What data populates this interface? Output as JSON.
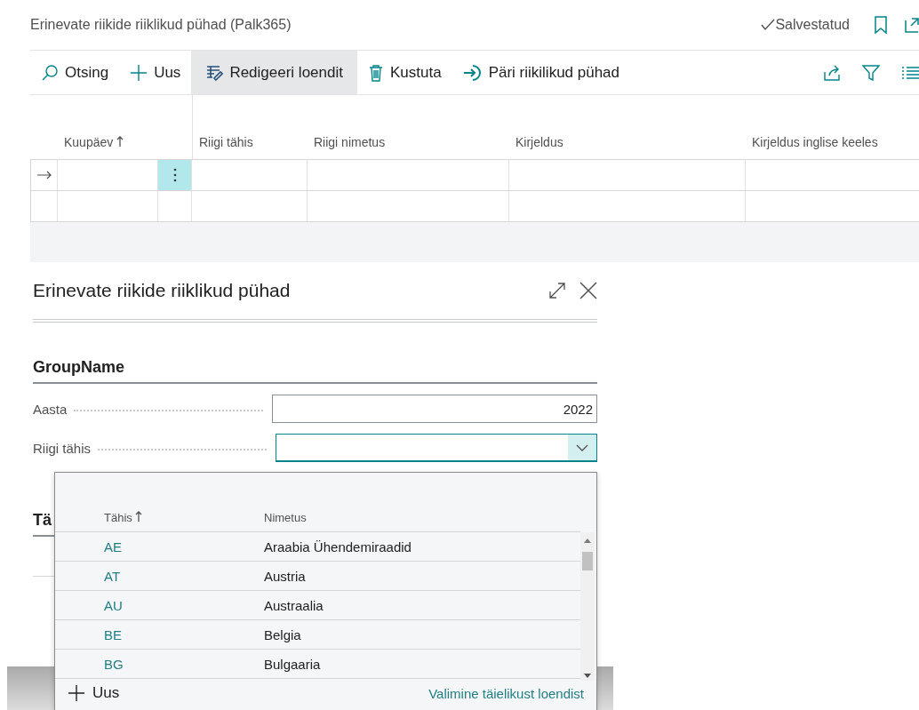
{
  "page": {
    "title": "Erinevate riikide riiklikud pühad (Palk365)",
    "status": "Salvestatud"
  },
  "actions": [
    {
      "label": "Otsing",
      "kind": "search",
      "highlighted": false
    },
    {
      "label": "Uus",
      "kind": "new",
      "highlighted": false
    },
    {
      "label": "Redigeeri loendit",
      "kind": "edit",
      "highlighted": true
    },
    {
      "label": "Kustuta",
      "kind": "delete",
      "highlighted": false
    },
    {
      "label": "Päri riikilikud pühad",
      "kind": "fetch",
      "highlighted": false
    }
  ],
  "grid": {
    "columns": [
      {
        "label": "Kuupäev",
        "sorted": true
      },
      {
        "label": "Riigi tähis",
        "sorted": false
      },
      {
        "label": "Riigi nimetus",
        "sorted": false
      },
      {
        "label": "Kirjeldus",
        "sorted": false
      },
      {
        "label": "Kirjeldus inglise keeles",
        "sorted": false
      }
    ],
    "rows": [
      {
        "current": true
      },
      {
        "current": false
      }
    ]
  },
  "dialog": {
    "title": "Erinevate riikide riiklikud pühad",
    "group": "GroupName",
    "fields": [
      {
        "label": "Aasta",
        "value": "2022",
        "kind": "text",
        "focused": false
      },
      {
        "label": "Riigi tähis",
        "kind": "lookup",
        "focused": true
      }
    ],
    "next_group": "Tä"
  },
  "lookup": {
    "columns": [
      {
        "label": "Tähis",
        "sorted": true
      },
      {
        "label": "Nimetus",
        "sorted": false
      }
    ],
    "rows": [
      {
        "code": "AE",
        "name": "Araabia Ühendemiraadid"
      },
      {
        "code": "AT",
        "name": "Austria"
      },
      {
        "code": "AU",
        "name": "Austraalia"
      },
      {
        "code": "BE",
        "name": "Belgia"
      },
      {
        "code": "BG",
        "name": "Bulgaaria"
      }
    ],
    "new_label": "Uus",
    "full_list_link": "Valimine täielikust loendist"
  }
}
